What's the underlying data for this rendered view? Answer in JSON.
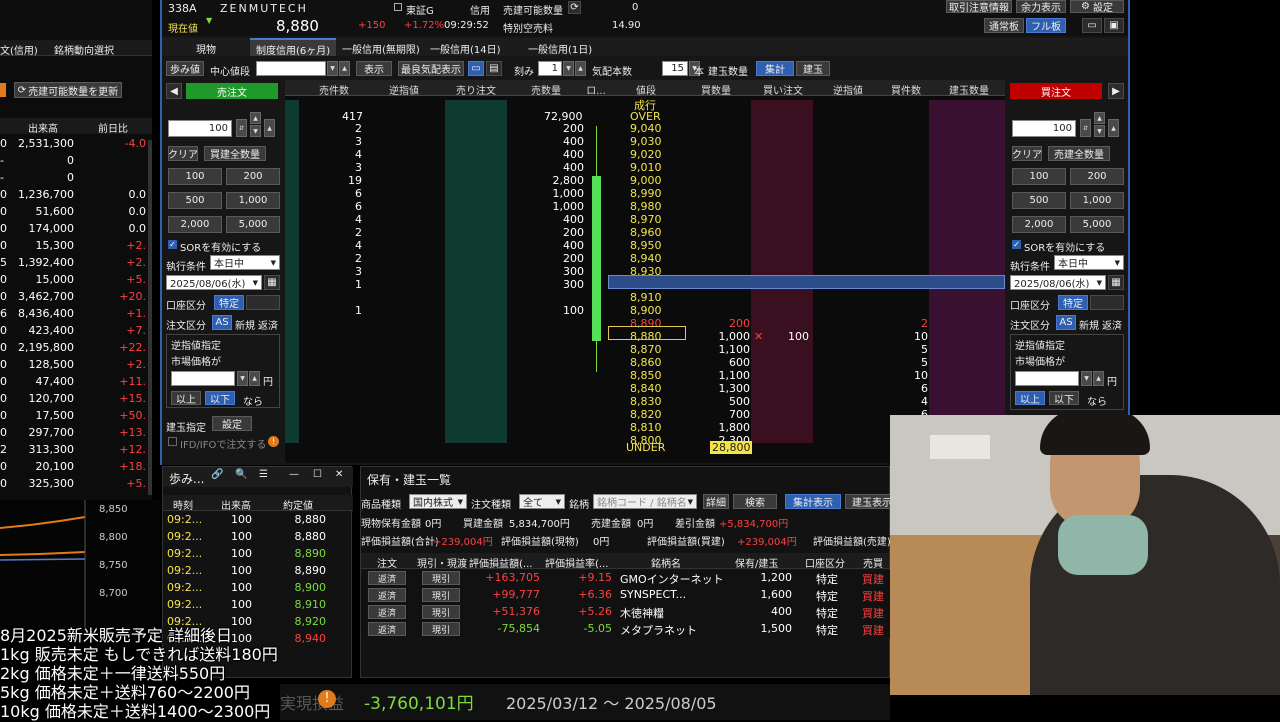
{
  "header": {
    "code": "338A",
    "name": "ZENMUTECH",
    "price_label": "現在値",
    "price": "8,880",
    "change": "+150",
    "change_pct": "+1.72%",
    "time": "09:29:52",
    "market": "東証G",
    "credit": "信用",
    "sellable_label": "売建可能数量",
    "sellable_value": "0",
    "special_fee_label": "特別空売料",
    "special_fee_value": "14.90",
    "btn_notice": "取引注意情報",
    "btn_margin": "余力表示",
    "btn_settings": "設定",
    "btn_normal": "通常板",
    "btn_full": "フル板"
  },
  "tabs": {
    "t1": "現物",
    "t2": "制度信用(6ヶ月)",
    "t3": "一般信用(無期限)",
    "t4": "一般信用(14日)",
    "t5": "一般信用(1日)"
  },
  "toolbar": {
    "step": "歩み値",
    "center_label": "中心値段",
    "center_value": "",
    "display_btn": "表示",
    "best_quote_btn": "最良気配表示",
    "tick_label": "刻み",
    "tick_value": "1",
    "quote_count_label": "気配本数",
    "quote_count_value": "15",
    "quote_count_unit": "本",
    "position_label": "建玉数量",
    "aggregate_btn": "集計",
    "position_btn": "建玉"
  },
  "left_panel": {
    "tab1": "文(信用)",
    "tab2": "銘柄動向選択",
    "update_btn": "売建可能数量を更新",
    "col_volume": "出来高",
    "col_change": "前日比",
    "rows": [
      {
        "a": "0",
        "v": "2,531,300",
        "c": "-4.0",
        "cc": "red"
      },
      {
        "a": "-",
        "v": "0",
        "c": "",
        "cc": "wht"
      },
      {
        "a": "-",
        "v": "0",
        "c": "",
        "cc": "wht"
      },
      {
        "a": "0",
        "v": "1,236,700",
        "c": "0.0",
        "cc": "wht"
      },
      {
        "a": "0",
        "v": "51,600",
        "c": "0.0",
        "cc": "wht"
      },
      {
        "a": "0",
        "v": "174,000",
        "c": "0.0",
        "cc": "wht"
      },
      {
        "a": "0",
        "v": "15,300",
        "c": "+2.",
        "cc": "red"
      },
      {
        "a": "5",
        "v": "1,392,400",
        "c": "+2.",
        "cc": "red"
      },
      {
        "a": "0",
        "v": "15,000",
        "c": "+5.",
        "cc": "red"
      },
      {
        "a": "0",
        "v": "3,462,700",
        "c": "+20.",
        "cc": "red"
      },
      {
        "a": "6",
        "v": "8,436,400",
        "c": "+1.",
        "cc": "red"
      },
      {
        "a": "0",
        "v": "423,400",
        "c": "+7.",
        "cc": "red"
      },
      {
        "a": "0",
        "v": "2,195,800",
        "c": "+22.",
        "cc": "red"
      },
      {
        "a": "0",
        "v": "128,500",
        "c": "+2.",
        "cc": "red"
      },
      {
        "a": "0",
        "v": "47,400",
        "c": "+11.",
        "cc": "red"
      },
      {
        "a": "0",
        "v": "120,700",
        "c": "+15.",
        "cc": "red"
      },
      {
        "a": "0",
        "v": "17,500",
        "c": "+50.",
        "cc": "red"
      },
      {
        "a": "0",
        "v": "297,700",
        "c": "+13.",
        "cc": "red"
      },
      {
        "a": "2",
        "v": "313,300",
        "c": "+12.",
        "cc": "red"
      },
      {
        "a": "0",
        "v": "20,100",
        "c": "+18.",
        "cc": "red"
      },
      {
        "a": "0",
        "v": "325,300",
        "c": "+5.",
        "cc": "red"
      }
    ]
  },
  "chart": {
    "ticks": [
      "8,850",
      "8,800",
      "8,750",
      "8,700"
    ]
  },
  "sell_panel": {
    "title": "売注文",
    "qty": "100",
    "clear": "クリア",
    "buy_all": "買建全数量",
    "q100": "100",
    "q200": "200",
    "q500": "500",
    "q1000": "1,000",
    "q2000": "2,000",
    "q5000": "5,000",
    "sor": "SORを有効にする",
    "exec_label": "執行条件",
    "exec_value": "本日中",
    "date": "2025/08/06(水)",
    "account_label": "口座区分",
    "account_value": "特定",
    "order_label": "注文区分",
    "as": "AS",
    "new": "新規",
    "repay": "返済",
    "stop_label": "逆指値指定",
    "market_price": "市場価格が",
    "yen": "円",
    "above": "以上",
    "below": "以下",
    "then": "なら",
    "pos_label": "建玉指定",
    "pos_btn": "設定",
    "ifd": "IFD/IFOで注文する"
  },
  "buy_panel": {
    "title": "買注文",
    "qty": "100",
    "clear": "クリア",
    "sell_all": "売建全数量",
    "q100": "100",
    "q200": "200",
    "q500": "500",
    "q1000": "1,000",
    "q2000": "2,000",
    "q5000": "5,000",
    "sor": "SORを有効にする",
    "exec_label": "執行条件",
    "exec_value": "本日中",
    "date": "2025/08/06(水)",
    "account_label": "口座区分",
    "account_value": "特定",
    "order_label": "注文区分",
    "as": "AS",
    "new": "新規",
    "repay": "返済",
    "stop_label": "逆指値指定",
    "market_price": "市場価格が",
    "yen": "円",
    "above": "以上",
    "below": "以下",
    "then": "なら"
  },
  "board": {
    "headers": {
      "sell_count": "売件数",
      "stop_sell": "逆指値",
      "sell_order": "売り注文",
      "sell_qty": "売数量",
      "mark": "ロ...",
      "price": "値段",
      "buy_qty": "買数量",
      "buy_order": "買い注文",
      "stop_buy": "逆指値",
      "buy_count": "買件数",
      "pos_qty": "建玉数量"
    },
    "market_label": "成行",
    "over_label": "OVER",
    "over_count": "417",
    "over_qty": "72,900",
    "under_label": "UNDER",
    "under_qty": "28,800",
    "asks": [
      {
        "n": "2",
        "q": "200",
        "p": "9,040"
      },
      {
        "n": "3",
        "q": "400",
        "p": "9,030"
      },
      {
        "n": "4",
        "q": "400",
        "p": "9,020"
      },
      {
        "n": "3",
        "q": "400",
        "p": "9,010"
      },
      {
        "n": "19",
        "q": "2,800",
        "p": "9,000"
      },
      {
        "n": "6",
        "q": "1,000",
        "p": "8,990"
      },
      {
        "n": "6",
        "q": "1,000",
        "p": "8,980"
      },
      {
        "n": "4",
        "q": "400",
        "p": "8,970"
      },
      {
        "n": "2",
        "q": "200",
        "p": "8,960"
      },
      {
        "n": "4",
        "q": "400",
        "p": "8,950"
      },
      {
        "n": "2",
        "q": "200",
        "p": "8,940"
      },
      {
        "n": "3",
        "q": "300",
        "p": "8,930"
      },
      {
        "n": "1",
        "q": "300",
        "p": "8,920"
      },
      {
        "n": "",
        "q": "",
        "p": "8,910"
      },
      {
        "n": "1",
        "q": "100",
        "p": "8,900"
      }
    ],
    "bids": [
      {
        "p": "8,890",
        "q": "200",
        "n": "2",
        "o": ""
      },
      {
        "p": "8,880",
        "q": "1,000",
        "n": "10",
        "o": "100"
      },
      {
        "p": "8,870",
        "q": "1,100",
        "n": "5",
        "o": ""
      },
      {
        "p": "8,860",
        "q": "600",
        "n": "5",
        "o": ""
      },
      {
        "p": "8,850",
        "q": "1,100",
        "n": "10",
        "o": ""
      },
      {
        "p": "8,840",
        "q": "1,300",
        "n": "6",
        "o": ""
      },
      {
        "p": "8,830",
        "q": "500",
        "n": "4",
        "o": ""
      },
      {
        "p": "8,820",
        "q": "700",
        "n": "6",
        "o": ""
      },
      {
        "p": "8,810",
        "q": "1,800",
        "n": "",
        "o": ""
      },
      {
        "p": "8,800",
        "q": "2,300",
        "n": "",
        "o": ""
      }
    ]
  },
  "ticks_panel": {
    "title": "歩み...",
    "col_time": "時刻",
    "col_vol": "出来高",
    "col_price": "約定値",
    "rows": [
      {
        "t": "09:2...",
        "v": "100",
        "p": "8,880",
        "c": "wht"
      },
      {
        "t": "09:2...",
        "v": "100",
        "p": "8,880",
        "c": "wht"
      },
      {
        "t": "09:2...",
        "v": "100",
        "p": "8,890",
        "c": "grn"
      },
      {
        "t": "09:2...",
        "v": "100",
        "p": "8,890",
        "c": "wht"
      },
      {
        "t": "09:2...",
        "v": "100",
        "p": "8,900",
        "c": "grn"
      },
      {
        "t": "09:2...",
        "v": "100",
        "p": "8,910",
        "c": "grn"
      },
      {
        "t": "09:2...",
        "v": "100",
        "p": "8,920",
        "c": "grn"
      },
      {
        "t": "09:2...",
        "v": "100",
        "p": "8,940",
        "c": "red"
      }
    ]
  },
  "holdings": {
    "title": "保有・建玉一覧",
    "product_label": "商品種類",
    "product_value": "国内株式",
    "order_type_label": "注文種類",
    "order_type_value": "全て",
    "symbol_label": "銘柄",
    "symbol_placeholder": "銘柄コード / 銘柄名",
    "detail_btn": "詳細",
    "search_btn": "検索",
    "aggregate_btn": "集計表示",
    "position_btn": "建玉表示",
    "cash_eval_label": "現物保有金額",
    "cash_eval": "0円",
    "buy_amount_label": "買建金額",
    "buy_amount": "5,834,700円",
    "sell_amount_label": "売建金額",
    "sell_amount": "0円",
    "diff_label": "差引金額",
    "diff": "+5,834,700円",
    "pl_total_label": "評価損益額(合計)",
    "pl_total": "+239,004円",
    "pl_cash_label": "評価損益額(現物)",
    "pl_cash": "0円",
    "pl_buy_label": "評価損益額(買建)",
    "pl_buy": "+239,004円",
    "pl_sell_label": "評価損益額(売建)",
    "cols": {
      "order": "注文",
      "receipt": "現引・現渡",
      "pl": "評価損益額(...",
      "plpct": "評価損益率(...",
      "name": "銘柄名",
      "hold": "保有/建玉",
      "account": "口座区分",
      "side": "売買"
    },
    "rows": [
      {
        "btn1": "返済",
        "btn2": "現引",
        "pl": "+163,705",
        "pct": "+9.15",
        "name": "GMOインターネット",
        "qty": "1,200",
        "acc": "特定",
        "side": "買建",
        "c": "red"
      },
      {
        "btn1": "返済",
        "btn2": "現引",
        "pl": "+99,777",
        "pct": "+6.36",
        "name": "SYNSPECT...",
        "qty": "1,600",
        "acc": "特定",
        "side": "買建",
        "c": "red"
      },
      {
        "btn1": "返済",
        "btn2": "現引",
        "pl": "+51,376",
        "pct": "+5.26",
        "name": "木徳神糧",
        "qty": "400",
        "acc": "特定",
        "side": "買建",
        "c": "red"
      },
      {
        "btn1": "返済",
        "btn2": "現引",
        "pl": "-75,854",
        "pct": "-5.05",
        "name": "メタプラネット",
        "qty": "1,500",
        "acc": "特定",
        "side": "買建",
        "c": "grn"
      }
    ]
  },
  "overlay": {
    "line1": "8月2025新米販売予定 詳細後日",
    "line2": "1kg 販売未定 もしできれば送料180円",
    "line3": "2kg 価格未定＋一律送料550円",
    "line4": "5kg 価格未定＋送料760～2200円",
    "line5": "10kg 価格未定＋送料1400～2300円",
    "pl_label": "実現損益",
    "pl_value": "-3,760,101円",
    "period": "2025/03/12 ～ 2025/08/05"
  },
  "colors": {
    "sell_title_bg": "#1f9a2a",
    "buy_title_bg": "#c00000",
    "accent_blue": "#2f5fb0",
    "up_red": "#ff4040",
    "down_green": "#7ddc3c"
  }
}
